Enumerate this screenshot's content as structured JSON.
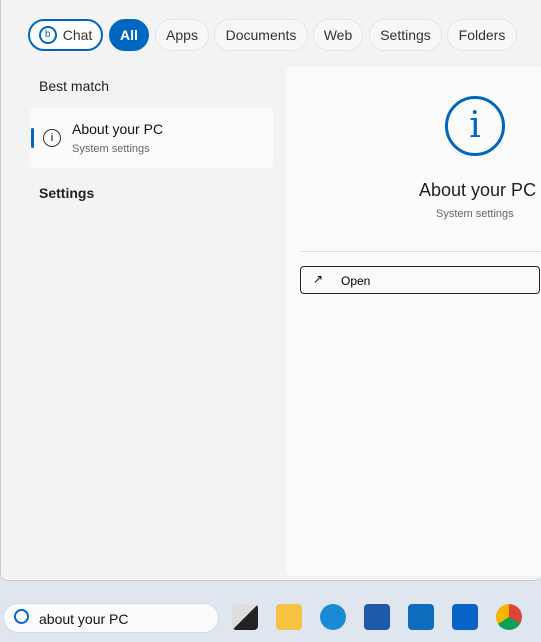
{
  "filters": [
    "Chat",
    "All",
    "Apps",
    "Documents",
    "Web",
    "Settings",
    "Folders"
  ],
  "active_filter": "All",
  "best_match_label": "Best match",
  "result": {
    "title": "About your PC",
    "subtitle": "System settings"
  },
  "settings_label": "Settings",
  "detail": {
    "title": "About your PC",
    "subtitle": "System settings",
    "open_label": "Open"
  },
  "search": {
    "value": "about your PC"
  },
  "taskbar": [
    "task-view",
    "file-explorer",
    "edge",
    "microsoft-store",
    "outlook-new",
    "outlook",
    "chrome"
  ],
  "accent": "#0067c0"
}
